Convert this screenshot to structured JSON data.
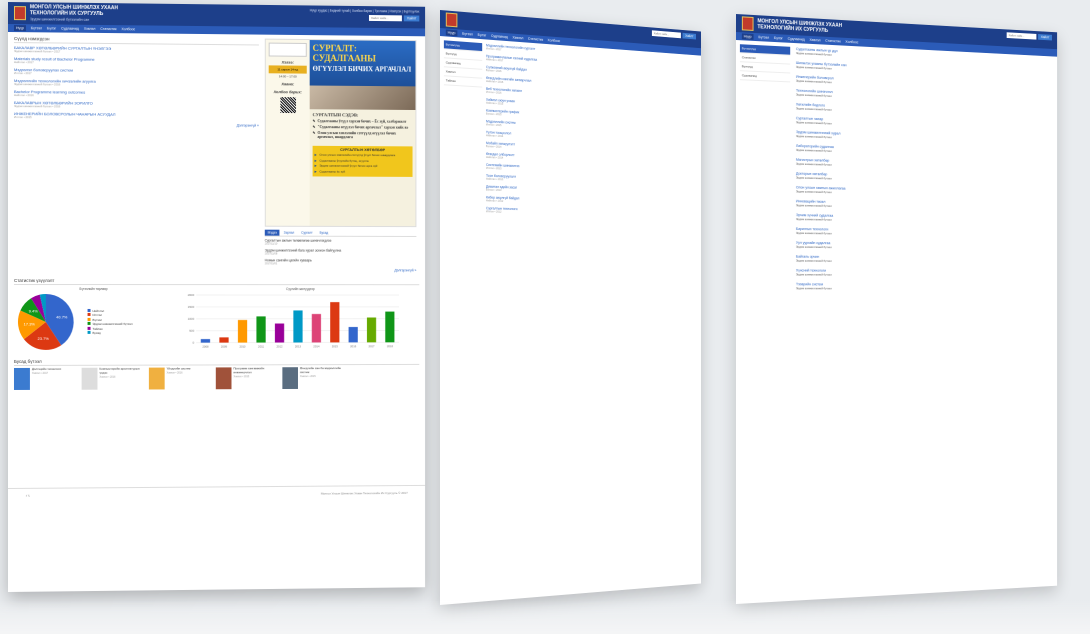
{
  "site": {
    "title": "МОНГОЛ УЛСЫН ШИНЖЛЭХ УХААН ТЕХНОЛОГИЙН ИХ СУРГУУЛЬ",
    "subtitle": "Эрдэм шинжилгээний бүтээлийн сан",
    "top_links": "Нүүр хуудас | Бидний тухай | Холбоо барих | Тусламж | Нэвтрэх | Бүртгүүлэх",
    "search_placeholder": "Хайлт хийх...",
    "search_button": "Хайлт",
    "brand_color": "#1d3f8a",
    "accent_color": "#2b5bb8"
  },
  "nav": {
    "items": [
      "Нүүр",
      "Бүтээл",
      "Бүлэг",
      "Судлаачид",
      "Хэвлэл",
      "Статистик",
      "Холбоос"
    ]
  },
  "news": {
    "section_title": "Сүүлд нэмэгдсэн",
    "more": "Дэлгэрэнгүй »",
    "items": [
      {
        "title": "БАКАЛАВР ХӨТӨЛБӨРИЙН СУРГАЛТЫН ҮНЭЛГЭЭ",
        "meta": "Эрдэм шинжилгээний бүтээл • 2017"
      },
      {
        "title": "Materials study result of Bachelor Programme",
        "meta": "Нийтлэл • 2017"
      },
      {
        "title": "Мэдээлэл боловсруулах систем",
        "meta": "Илтгэл • 2017"
      },
      {
        "title": "Мэдээллийн технологийн хичээлийн агуулга",
        "meta": "Эрдэм шинжилгээний бүтээл • 2016"
      },
      {
        "title": "Bachelor Programme learning outcomes",
        "meta": "Нийтлэл • 2016"
      },
      {
        "title": "БАКАЛАВРЫН ХӨТӨЛБӨРИЙН ЗОРИЛГО",
        "meta": "Эрдэм шинжилгээний бүтээл • 2016"
      },
      {
        "title": "ИНЖЕНЕРИЙН БОЛОВСРОЛЫН ЧАНАРЫН АСУУДАЛ",
        "meta": "Илтгэл • 2015"
      }
    ]
  },
  "poster": {
    "banner_title_1": "СУРГАЛТ:",
    "banner_title_2": "СУДАЛГААНЫ",
    "banner_title_3": "ӨГҮҮЛЭЛ БИЧИХ АРГАЧЛАЛ",
    "left_head_1": "Хэзээ:",
    "left_date": "11 сарын 14-нд",
    "left_time": "14:00 – 17:00",
    "left_head_2": "Хаана:",
    "left_head_3": "Холбоо барих:",
    "list_title": "СУРГАЛТЫН СЭДЭВ:",
    "list_items": [
      "Судалгааны ўгүүл хэрхэн бичих – Ёс зүй, хэлбэржилт",
      "\"Судалгааны өгүүлэл бичих аргачлал\" хэрхэн хийх вэ",
      "Олон улсын хэвлэлийн сэтгүүлд өгүүлэл бичих аргачлал, шаардлага"
    ],
    "yellow_title": "СУРГАЛТЫН ХӨТӨЛБӨР",
    "yellow_items": [
      "Олон улсын хэвлэлийн сэтгүүлд ўгүүл бичих шаардлага",
      "Судалгааны ўгүүлийн бүтэц, агуулга",
      "Эрдэм шинжилгээний ўгүүл бичих арга зүй",
      "Судалгааны ёс зүй"
    ]
  },
  "tabs": {
    "labels": [
      "Мэдээ",
      "Зарлал",
      "Сургалт",
      "Бусад"
    ],
    "items": [
      {
        "title": "Сургалтын ажлын төлөвлөгөө шинэчлэгдлээ",
        "meta": "2017/11/10"
      },
      {
        "title": "Эрдэм шинжилгээний бага хурал зохион байгуулна",
        "meta": "2017/11/08"
      },
      {
        "title": "Номын сангийн цагийн хуваарь",
        "meta": "2017/11/01"
      }
    ],
    "more": "Дэлгэрэнгүй »"
  },
  "stats": {
    "section_title": "Статистик үзүүлэлт",
    "pie_caption": "Бүтээлийн төрлөөр",
    "bar_caption": "Сүүлийн жилүүдээр",
    "legend": [
      "Нийтлэл",
      "Илтгэл",
      "Бүтээл",
      "Эрдэм шинжилгээний бүтээл",
      "Тайлан",
      "Бусад"
    ]
  },
  "chart_data": [
    {
      "type": "pie",
      "title": "Бүтээлийн төрлөөр",
      "categories": [
        "Нийтлэл",
        "Илтгэл",
        "Бүтээл",
        "Эрдэм шинжилгээний бүтээл",
        "Тайлан",
        "Бусад"
      ],
      "values": [
        40.7,
        23.7,
        17.3,
        9.4,
        5.4,
        3.5
      ],
      "labels": [
        "40.7%",
        "23.7%",
        "17.3%",
        "9.4%",
        "",
        ""
      ],
      "colors": [
        "#3366cc",
        "#dc3912",
        "#ff9900",
        "#109618",
        "#990099",
        "#0099c6"
      ]
    },
    {
      "type": "bar",
      "title": "Сүүлийн жилүүдээр",
      "categories": [
        "2008",
        "2009",
        "2010",
        "2011",
        "2012",
        "2013",
        "2014",
        "2015",
        "2016",
        "2017",
        "2018"
      ],
      "values": [
        150,
        220,
        950,
        1100,
        800,
        1350,
        1200,
        1700,
        650,
        1050,
        1300
      ],
      "colors": [
        "#3366cc",
        "#dc3912",
        "#ff9900",
        "#109618",
        "#990099",
        "#0099c6",
        "#dd4477",
        "#dc3912",
        "#3366cc",
        "#66aa00",
        "#109618"
      ],
      "ylim": [
        0,
        2000
      ],
      "yticks": [
        "2000",
        "1500",
        "1000",
        "500",
        "0"
      ],
      "grid": true
    }
  ],
  "books": {
    "section_title": "Бусад бүтээл",
    "items": [
      {
        "title": "Дэлгэцийн технологи",
        "meta": "Хэвлэл • 2017",
        "color": "#3b7bd0"
      },
      {
        "title": "Компьютерийн архитектурын үндэс",
        "meta": "Хэвлэл • 2016",
        "color": "#dddddd"
      },
      {
        "title": "Үйлдлийн систем",
        "meta": "Хэвлэл • 2016",
        "color": "#f0b040"
      },
      {
        "title": "Программ хангамжийн инженерчлэл",
        "meta": "Хэвлэл • 2015",
        "color": "#a0523a"
      },
      {
        "title": "Өгөгдлийн сан ба мэдээллийн систем",
        "meta": "Хэвлэл • 2015",
        "color": "#5a6d80"
      }
    ]
  },
  "footer": {
    "social": "f  𝕏",
    "copyright": "Монгол Улсын Шинжлэх Ухаан Технологийн Их Сургууль © 2017"
  },
  "mid_page": {
    "side_items": [
      "Бүтээлүүд",
      "Бүлгүүд",
      "Судлаачид",
      "Хэвлэл",
      "Тайлан"
    ],
    "items": [
      {
        "title": "Мэдээллийн технологийн сургалт",
        "meta": "Илтгэл • 2017"
      },
      {
        "title": "Программчлалын хэлний судалгаа",
        "meta": "Нийтлэл • 2017"
      },
      {
        "title": "Сүлжээний аюулгүй байдал",
        "meta": "Бүтээл • 2016"
      },
      {
        "title": "Өгөгдлийн сангийн загварчлал",
        "meta": "Нийтлэл • 2016"
      },
      {
        "title": "Веб технологийн хөгжил",
        "meta": "Илтгэл • 2016"
      },
      {
        "title": "Хиймэл оюун ухаан",
        "meta": "Нийтлэл • 2015"
      },
      {
        "title": "Компьютерийн график",
        "meta": "Бүтээл • 2015"
      },
      {
        "title": "Мэдээллийн систем",
        "meta": "Илтгэл • 2015"
      },
      {
        "title": "Үүлэн тооцоолол",
        "meta": "Нийтлэл • 2014"
      },
      {
        "title": "Мобайл хөгжүүлэлт",
        "meta": "Бүтээл • 2014"
      },
      {
        "title": "Өгөгдөл олборлолт",
        "meta": "Нийтлэл • 2014"
      },
      {
        "title": "Системийн шинжилгээ",
        "meta": "Илтгэл • 2013"
      },
      {
        "title": "Тоон боловсруулалт",
        "meta": "Нийтлэл • 2013"
      },
      {
        "title": "Дижитал эдийн засаг",
        "meta": "Бүтээл • 2013"
      },
      {
        "title": "Кибер аюулгүй байдал",
        "meta": "Нийтлэл • 2012"
      },
      {
        "title": "Сургалтын технологи",
        "meta": "Илтгэл • 2012"
      }
    ]
  },
  "right_page": {
    "side_items": [
      "Бүтээлүүд",
      "Статистик",
      "Бүлгүүд",
      "Судлаачид"
    ],
    "items": [
      {
        "title": "Судалгааны ажлын үр дүн",
        "meta": "Эрдэм шинжилгээний бүтээл"
      },
      {
        "title": "Шинжлэх ухааны бүтээлийн сан",
        "meta": "Эрдэм шинжилгээний бүтээл"
      },
      {
        "title": "Инженерийн боловсрол",
        "meta": "Эрдэм шинжилгээний бүтээл"
      },
      {
        "title": "Технологийн шинэчлэл",
        "meta": "Эрдэм шинжилгээний бүтээл"
      },
      {
        "title": "Хөгжлийн бодлого",
        "meta": "Эрдэм шинжилгээний бүтээл"
      },
      {
        "title": "Сургалтын чанар",
        "meta": "Эрдэм шинжилгээний бүтээл"
      },
      {
        "title": "Эрдэм шинжилгээний хурал",
        "meta": "Эрдэм шинжилгээний бүтээл"
      },
      {
        "title": "Лабораторийн судалгаа",
        "meta": "Эрдэм шинжилгээний бүтээл"
      },
      {
        "title": "Магистрын хөтөлбөр",
        "meta": "Эрдэм шинжилгээний бүтээл"
      },
      {
        "title": "Докторын хөтөлбөр",
        "meta": "Эрдэм шинжилгээний бүтээл"
      },
      {
        "title": "Олон улсын хамтын ажиллагаа",
        "meta": "Эрдэм шинжилгээний бүтээл"
      },
      {
        "title": "Инновацийн төсөл",
        "meta": "Эрдэм шинжилгээний бүтээл"
      },
      {
        "title": "Эрчим хүчний судалгаа",
        "meta": "Эрдэм шинжилгээний бүтээл"
      },
      {
        "title": "Барилгын технологи",
        "meta": "Эрдэм шинжилгээний бүтээл"
      },
      {
        "title": "Уул уурхайн судалгаа",
        "meta": "Эрдэм шинжилгээний бүтээл"
      },
      {
        "title": "Байгаль орчин",
        "meta": "Эрдэм шинжилгээний бүтээл"
      },
      {
        "title": "Хүнсний технологи",
        "meta": "Эрдэм шинжилгээний бүтээл"
      },
      {
        "title": "Тээврийн систем",
        "meta": "Эрдэм шинжилгээний бүтээл"
      }
    ]
  }
}
